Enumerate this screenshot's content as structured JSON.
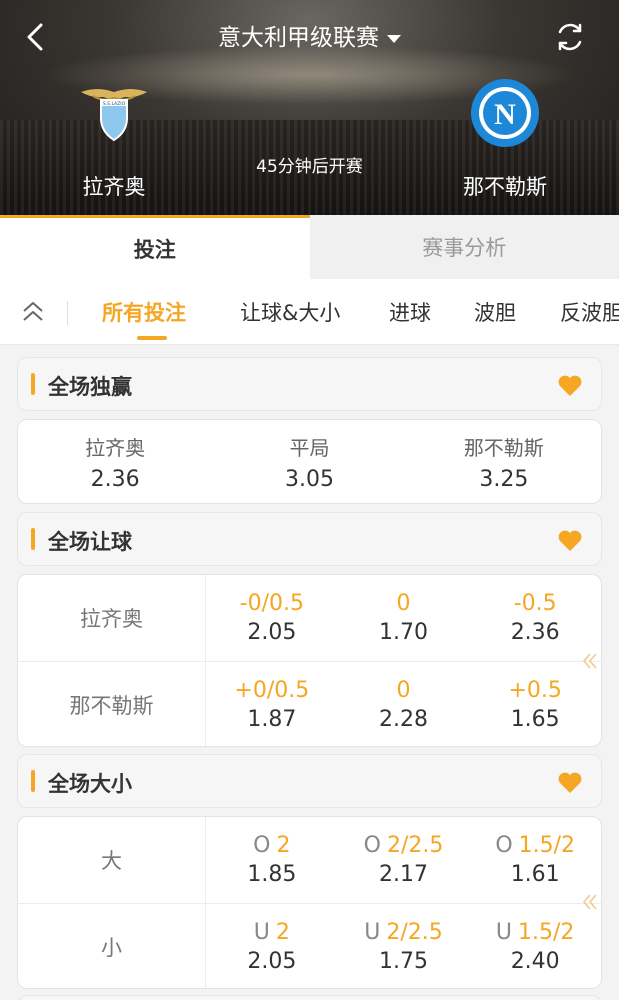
{
  "header": {
    "title": "意大利甲级联赛",
    "kickoff": "45分钟后开赛",
    "home_team": "拉齐奥",
    "away_team": "那不勒斯",
    "home_logo_text": "S.S.LAZIO",
    "away_logo_text": "N"
  },
  "tabs": [
    {
      "label": "投注",
      "active": true
    },
    {
      "label": "赛事分析",
      "active": false
    }
  ],
  "subnav": [
    "所有投注",
    "让球&大小",
    "进球",
    "波胆",
    "反波胆"
  ],
  "sections": {
    "win": {
      "title": "全场独赢",
      "options": [
        {
          "name": "拉齐奥",
          "odd": "2.36"
        },
        {
          "name": "平局",
          "odd": "3.05"
        },
        {
          "name": "那不勒斯",
          "odd": "3.25"
        }
      ]
    },
    "handicap": {
      "title": "全场让球",
      "rows": [
        {
          "team": "拉齐奥",
          "opts": [
            {
              "line": "-0/0.5",
              "odd": "2.05"
            },
            {
              "line": "0",
              "odd": "1.70"
            },
            {
              "line": "-0.5",
              "odd": "2.36"
            }
          ]
        },
        {
          "team": "那不勒斯",
          "opts": [
            {
              "line": "+0/0.5",
              "odd": "1.87"
            },
            {
              "line": "0",
              "odd": "2.28"
            },
            {
              "line": "+0.5",
              "odd": "1.65"
            }
          ]
        }
      ]
    },
    "totals": {
      "title": "全场大小",
      "rows": [
        {
          "team": "大",
          "opts": [
            {
              "prefix": "O",
              "line": "2",
              "odd": "1.85"
            },
            {
              "prefix": "O",
              "line": "2/2.5",
              "odd": "2.17"
            },
            {
              "prefix": "O",
              "line": "1.5/2",
              "odd": "1.61"
            }
          ]
        },
        {
          "team": "小",
          "opts": [
            {
              "prefix": "U",
              "line": "2",
              "odd": "2.05"
            },
            {
              "prefix": "U",
              "line": "2/2.5",
              "odd": "1.75"
            },
            {
              "prefix": "U",
              "line": "1.5/2",
              "odd": "2.40"
            }
          ]
        }
      ]
    }
  },
  "colors": {
    "accent": "#f5a623",
    "napoli_blue": "#1e88d8",
    "lazio_blue": "#8ec8ec"
  }
}
